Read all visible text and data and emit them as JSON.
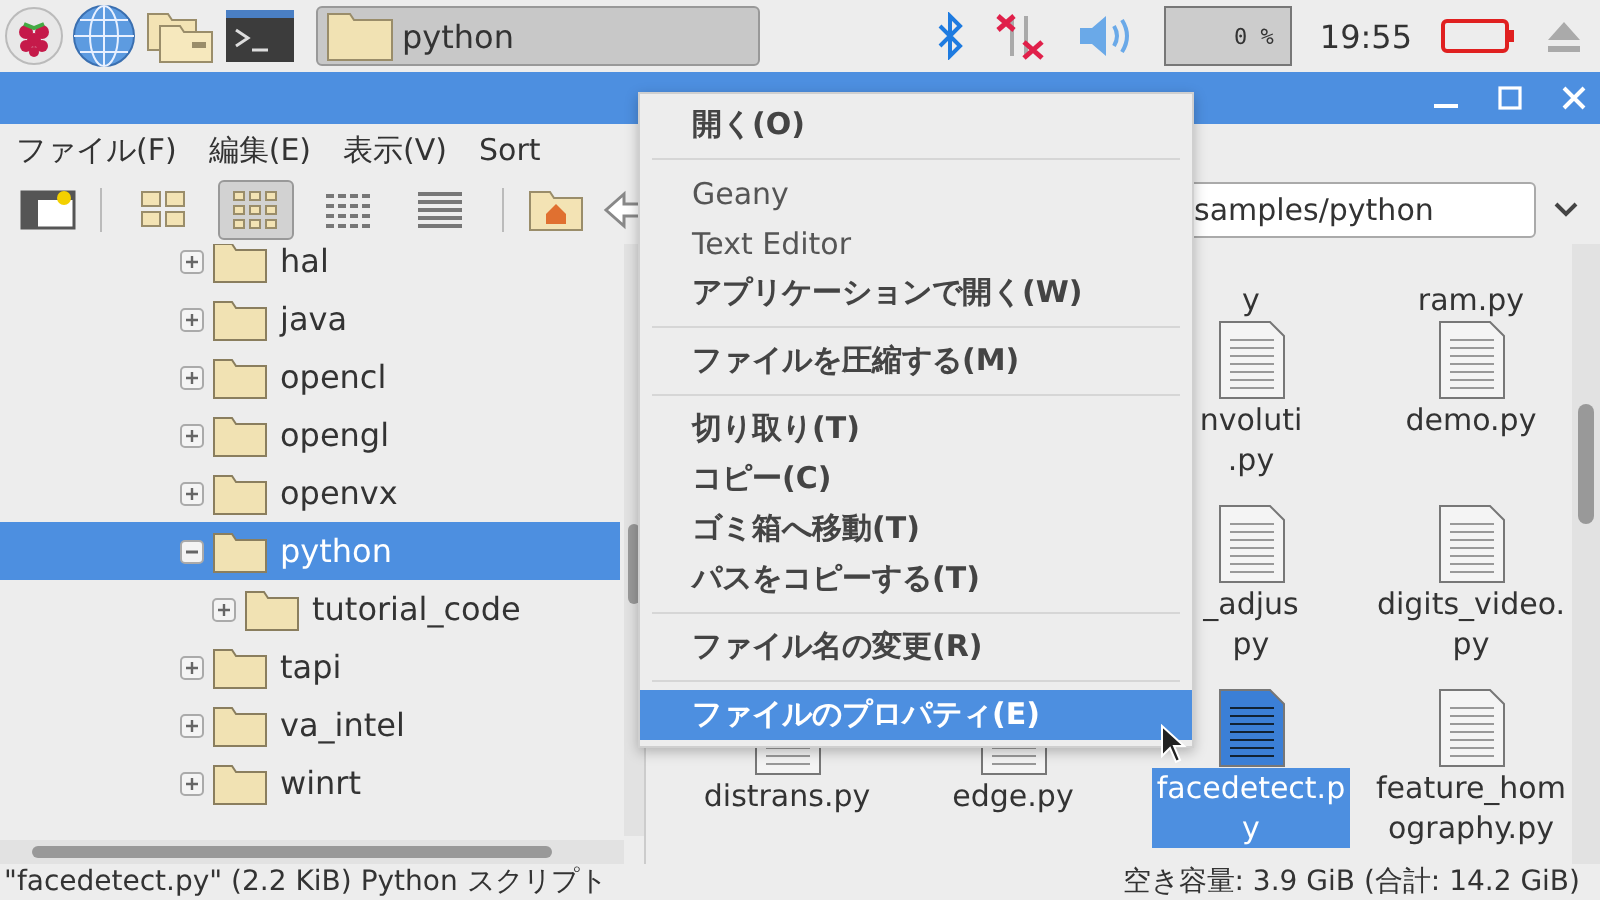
{
  "taskbar": {
    "task": {
      "label": "python"
    },
    "cpu": "0 %",
    "clock": "19:55"
  },
  "menubar": [
    "ファイル(F)",
    "編集(E)",
    "表示(V)",
    "Sort"
  ],
  "toolbar": {
    "view_modes": [
      {
        "selected": false
      },
      {
        "selected": true
      },
      {
        "selected": false
      },
      {
        "selected": false
      }
    ],
    "path": "samples/python"
  },
  "tree": [
    {
      "label": "hal",
      "expanded": false,
      "selected": false
    },
    {
      "label": "java",
      "expanded": false,
      "selected": false
    },
    {
      "label": "opencl",
      "expanded": false,
      "selected": false
    },
    {
      "label": "opengl",
      "expanded": false,
      "selected": false
    },
    {
      "label": "openvx",
      "expanded": false,
      "selected": false
    },
    {
      "label": "python",
      "expanded": true,
      "selected": true,
      "children": [
        {
          "label": "tutorial_code",
          "expanded": false,
          "selected": false
        }
      ]
    },
    {
      "label": "tapi",
      "expanded": false,
      "selected": false
    },
    {
      "label": "va_intel",
      "expanded": false,
      "selected": false
    },
    {
      "label": "winrt",
      "expanded": false,
      "selected": false
    }
  ],
  "files_left": [
    {
      "lines": [
        "distrans.py"
      ],
      "icon": true,
      "selected": false
    },
    {
      "lines": [
        "edge.py"
      ],
      "icon": true,
      "selected": false
    }
  ],
  "files_right": [
    {
      "lines": [
        "y"
      ],
      "icon": false,
      "selected": false
    },
    {
      "lines": [
        "ram.py"
      ],
      "icon": false,
      "selected": false
    },
    {
      "lines": [
        "nvoluti",
        ".py"
      ],
      "icon": true,
      "selected": false
    },
    {
      "lines": [
        "demo.py"
      ],
      "icon": true,
      "selected": false
    },
    {
      "lines": [
        "_adjus",
        "py"
      ],
      "icon": true,
      "selected": false
    },
    {
      "lines": [
        "digits_video.",
        "py"
      ],
      "icon": true,
      "selected": false
    },
    {
      "lines": [
        "facedetect.p",
        "y"
      ],
      "icon": true,
      "selected": true
    },
    {
      "lines": [
        "feature_hom",
        "ography.py"
      ],
      "icon": true,
      "selected": false
    }
  ],
  "context_menu": [
    {
      "kind": "item",
      "label": "開く(O)",
      "bold": true,
      "selected": false
    },
    {
      "kind": "separator"
    },
    {
      "kind": "item",
      "label": "Geany",
      "bold": false,
      "selected": false
    },
    {
      "kind": "item",
      "label": "Text Editor",
      "bold": false,
      "selected": false
    },
    {
      "kind": "item",
      "label": "アプリケーションで開く(W)",
      "bold": true,
      "selected": false
    },
    {
      "kind": "separator"
    },
    {
      "kind": "item",
      "label": "ファイルを圧縮する(M)",
      "bold": true,
      "selected": false
    },
    {
      "kind": "separator"
    },
    {
      "kind": "item",
      "label": "切り取り(T)",
      "bold": true,
      "selected": false
    },
    {
      "kind": "item",
      "label": "コピー(C)",
      "bold": true,
      "selected": false
    },
    {
      "kind": "item",
      "label": "ゴミ箱へ移動(T)",
      "bold": true,
      "selected": false
    },
    {
      "kind": "item",
      "label": "パスをコピーする(T)",
      "bold": true,
      "selected": false
    },
    {
      "kind": "separator"
    },
    {
      "kind": "item",
      "label": "ファイル名の変更(R)",
      "bold": true,
      "selected": false
    },
    {
      "kind": "separator"
    },
    {
      "kind": "item",
      "label": "ファイルのプロパティ(E)",
      "bold": true,
      "selected": true
    }
  ],
  "status_bar": {
    "left": "\"facedetect.py\" (2.2 KiB) Python スクリプト",
    "right": "空き容量: 3.9 GiB (合計: 14.2 GiB)"
  }
}
